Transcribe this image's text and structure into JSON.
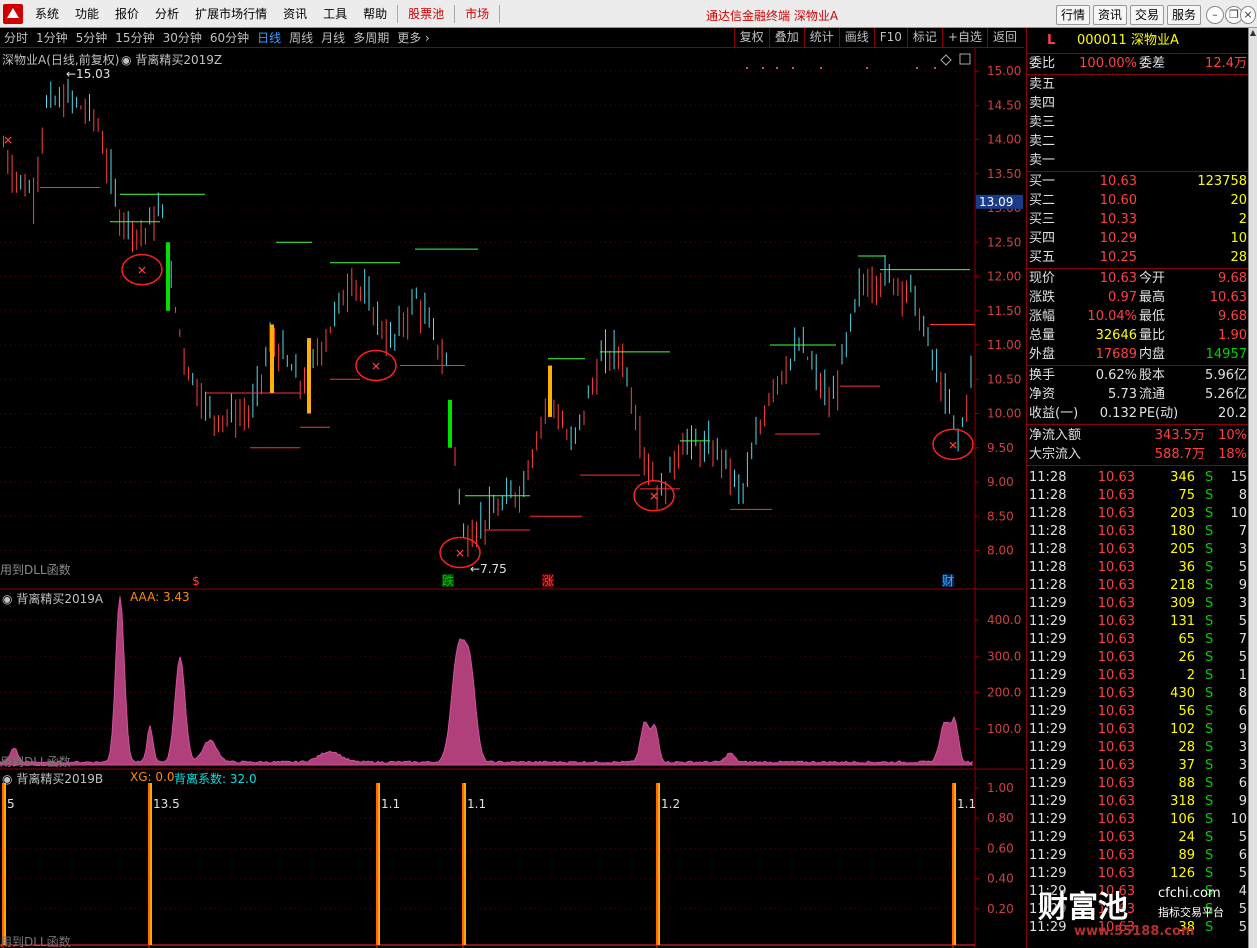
{
  "menubar": {
    "items": [
      "系统",
      "功能",
      "报价",
      "分析",
      "扩展市场行情",
      "资讯",
      "工具",
      "帮助"
    ],
    "highlight_items": [
      "股票池",
      "市场"
    ],
    "app_title": "通达信金融终端  深物业A",
    "right_buttons": [
      "行情",
      "资讯",
      "交易",
      "服务"
    ]
  },
  "periods": [
    "分时",
    "1分钟",
    "5分钟",
    "15分钟",
    "30分钟",
    "60分钟",
    "日线",
    "周线",
    "月线",
    "多周期",
    "更多"
  ],
  "active_period": "日线",
  "toolbar": [
    "复权",
    "叠加",
    "统计",
    "画线",
    "F10",
    "标记",
    "+自选",
    "返回"
  ],
  "main_chart": {
    "title": "深物业A(日线,前复权)",
    "indicator": "背离精买2019Z",
    "high_label": "15.03",
    "low_label": "7.75",
    "current_price_tag": "13.09",
    "dll_note": "用到DLL函数",
    "markers": [
      {
        "text": "$",
        "color": "#ff4040"
      },
      {
        "text": "跌",
        "color": "#00d000"
      },
      {
        "text": "涨",
        "color": "#ff4040"
      },
      {
        "text": "财",
        "color": "#4aa8ff"
      }
    ],
    "y_ticks": [
      "15.00",
      "14.50",
      "14.00",
      "13.50",
      "13.00",
      "12.50",
      "12.00",
      "11.50",
      "11.00",
      "10.50",
      "10.00",
      "9.50",
      "9.00",
      "8.50",
      "8.00"
    ]
  },
  "sub_chart_a": {
    "name": "背离精买2019A",
    "value_label": "AAA: 3.43",
    "dll_note": "用到DLL函数",
    "y_ticks": [
      "400.0",
      "300.0",
      "200.0",
      "100.0"
    ]
  },
  "sub_chart_b": {
    "name": "背离精买2019B",
    "xg_label": "XG: 0.0",
    "coef_label": "背离系数: 32.0",
    "dll_note": "用到DLL函数",
    "y_ticks": [
      "1.00",
      "0.80",
      "0.60",
      "0.40",
      "0.20"
    ],
    "signal_labels": [
      "5",
      "13.5",
      "1.1",
      "1.1",
      "1.2",
      "1.1"
    ]
  },
  "quote": {
    "flag": "L",
    "code": "000011",
    "name": "深物业A",
    "weibi_label": "委比",
    "weibi": "100.00%",
    "weicha_label": "委差",
    "weicha": "12.4万",
    "sell": [
      "卖五",
      "卖四",
      "卖三",
      "卖二",
      "卖一"
    ],
    "buy": [
      {
        "label": "买一",
        "price": "10.63",
        "vol": "123758"
      },
      {
        "label": "买二",
        "price": "10.60",
        "vol": "20"
      },
      {
        "label": "买三",
        "price": "10.33",
        "vol": "2"
      },
      {
        "label": "买四",
        "price": "10.29",
        "vol": "10"
      },
      {
        "label": "买五",
        "price": "10.25",
        "vol": "28"
      }
    ],
    "stats": [
      {
        "l1": "现价",
        "v1": "10.63",
        "c1": "red",
        "l2": "今开",
        "v2": "9.68",
        "c2": "red"
      },
      {
        "l1": "涨跌",
        "v1": "0.97",
        "c1": "red",
        "l2": "最高",
        "v2": "10.63",
        "c2": "red"
      },
      {
        "l1": "涨幅",
        "v1": "10.04%",
        "c1": "red",
        "l2": "最低",
        "v2": "9.68",
        "c2": "red"
      },
      {
        "l1": "总量",
        "v1": "32646",
        "c1": "yel",
        "l2": "量比",
        "v2": "1.90",
        "c2": "red"
      },
      {
        "l1": "外盘",
        "v1": "17689",
        "c1": "red",
        "l2": "内盘",
        "v2": "14957",
        "c2": "grn"
      }
    ],
    "stats2": [
      {
        "l1": "换手",
        "v1": "0.62%",
        "l2": "股本",
        "v2": "5.96亿"
      },
      {
        "l1": "净资",
        "v1": "5.73",
        "l2": "流通",
        "v2": "5.26亿"
      },
      {
        "l1": "收益(一)",
        "v1": "0.132",
        "l2": "PE(动)",
        "v2": "20.2"
      }
    ],
    "flows": [
      {
        "label": "净流入额",
        "value": "343.5万",
        "pct": "10%"
      },
      {
        "label": "大宗流入",
        "value": "588.7万",
        "pct": "18%"
      }
    ],
    "ticks": [
      [
        "11:28",
        "10.63",
        "346",
        "S",
        "15"
      ],
      [
        "11:28",
        "10.63",
        "75",
        "S",
        "8"
      ],
      [
        "11:28",
        "10.63",
        "203",
        "S",
        "10"
      ],
      [
        "11:28",
        "10.63",
        "180",
        "S",
        "7"
      ],
      [
        "11:28",
        "10.63",
        "205",
        "S",
        "3"
      ],
      [
        "11:28",
        "10.63",
        "36",
        "S",
        "5"
      ],
      [
        "11:28",
        "10.63",
        "218",
        "S",
        "9"
      ],
      [
        "11:29",
        "10.63",
        "309",
        "S",
        "3"
      ],
      [
        "11:29",
        "10.63",
        "131",
        "S",
        "5"
      ],
      [
        "11:29",
        "10.63",
        "65",
        "S",
        "7"
      ],
      [
        "11:29",
        "10.63",
        "26",
        "S",
        "5"
      ],
      [
        "11:29",
        "10.63",
        "2",
        "S",
        "1"
      ],
      [
        "11:29",
        "10.63",
        "430",
        "S",
        "8"
      ],
      [
        "11:29",
        "10.63",
        "56",
        "S",
        "6"
      ],
      [
        "11:29",
        "10.63",
        "102",
        "S",
        "9"
      ],
      [
        "11:29",
        "10.63",
        "28",
        "S",
        "3"
      ],
      [
        "11:29",
        "10.63",
        "37",
        "S",
        "3"
      ],
      [
        "11:29",
        "10.63",
        "88",
        "S",
        "6"
      ],
      [
        "11:29",
        "10.63",
        "318",
        "S",
        "9"
      ],
      [
        "11:29",
        "10.63",
        "106",
        "S",
        "10"
      ],
      [
        "11:29",
        "10.63",
        "24",
        "S",
        "5"
      ],
      [
        "11:29",
        "10.63",
        "89",
        "S",
        "6"
      ],
      [
        "11:29",
        "10.63",
        "126",
        "S",
        "5"
      ],
      [
        "11:29",
        "10.63",
        "",
        "S",
        "4"
      ],
      [
        "11:29",
        "10.63",
        "",
        "S",
        "5"
      ],
      [
        "11:29",
        "10.63",
        "38",
        "S",
        "5"
      ]
    ]
  },
  "watermark": {
    "brand": "财富池",
    "site": "cfchi.com",
    "sub": "指标交易平台",
    "url": "www.55188.com"
  }
}
